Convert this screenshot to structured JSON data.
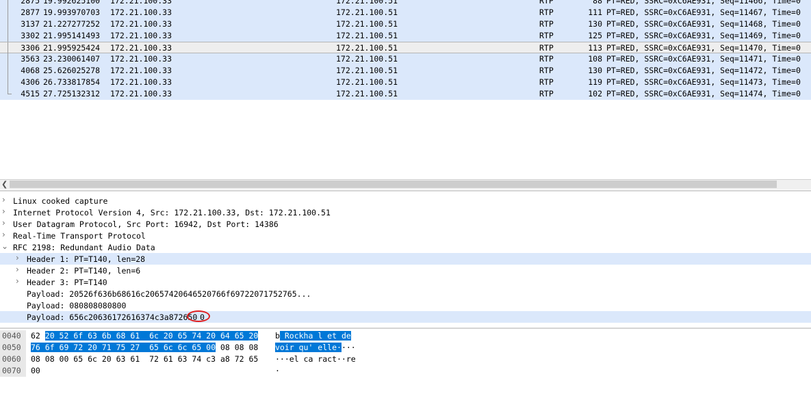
{
  "packet_list": {
    "rows": [
      {
        "no": "2875",
        "time": "19.992625100",
        "src": "172.21.100.33",
        "dst": "172.21.100.51",
        "proto": "RTP",
        "len": "88",
        "info": "PT=RED, SSRC=0xC6AE931, Seq=11466, Time=0"
      },
      {
        "no": "2877",
        "time": "19.993970703",
        "src": "172.21.100.33",
        "dst": "172.21.100.51",
        "proto": "RTP",
        "len": "111",
        "info": "PT=RED, SSRC=0xC6AE931, Seq=11467, Time=0"
      },
      {
        "no": "3137",
        "time": "21.227277252",
        "src": "172.21.100.33",
        "dst": "172.21.100.51",
        "proto": "RTP",
        "len": "130",
        "info": "PT=RED, SSRC=0xC6AE931, Seq=11468, Time=0"
      },
      {
        "no": "3302",
        "time": "21.995141493",
        "src": "172.21.100.33",
        "dst": "172.21.100.51",
        "proto": "RTP",
        "len": "125",
        "info": "PT=RED, SSRC=0xC6AE931, Seq=11469, Time=0"
      },
      {
        "no": "3306",
        "time": "21.995925424",
        "src": "172.21.100.33",
        "dst": "172.21.100.51",
        "proto": "RTP",
        "len": "113",
        "info": "PT=RED, SSRC=0xC6AE931, Seq=11470, Time=0"
      },
      {
        "no": "3563",
        "time": "23.230061407",
        "src": "172.21.100.33",
        "dst": "172.21.100.51",
        "proto": "RTP",
        "len": "108",
        "info": "PT=RED, SSRC=0xC6AE931, Seq=11471, Time=0"
      },
      {
        "no": "4068",
        "time": "25.626025278",
        "src": "172.21.100.33",
        "dst": "172.21.100.51",
        "proto": "RTP",
        "len": "130",
        "info": "PT=RED, SSRC=0xC6AE931, Seq=11472, Time=0"
      },
      {
        "no": "4306",
        "time": "26.733817854",
        "src": "172.21.100.33",
        "dst": "172.21.100.51",
        "proto": "RTP",
        "len": "119",
        "info": "PT=RED, SSRC=0xC6AE931, Seq=11473, Time=0"
      },
      {
        "no": "4515",
        "time": "27.725132312",
        "src": "172.21.100.33",
        "dst": "172.21.100.51",
        "proto": "RTP",
        "len": "102",
        "info": "PT=RED, SSRC=0xC6AE931, Seq=11474, Time=0"
      }
    ],
    "selected_row": "3306"
  },
  "details": {
    "linux_cooked": "Linux cooked capture",
    "ipv4": "Internet Protocol Version 4, Src: 172.21.100.33, Dst: 172.21.100.51",
    "udp": "User Datagram Protocol, Src Port: 16942, Dst Port: 14386",
    "rtp": "Real-Time Transport Protocol",
    "rfc2198": "RFC 2198: Redundant Audio Data",
    "header1": "Header 1: PT=T140, len=28",
    "header2": "Header 2: PT=T140, len=6",
    "header3": "Header 3: PT=T140",
    "payload1": "Payload: 20526f636b68616c20657420646520766f69722071752765...",
    "payload2": "Payload: 080808080800",
    "payload3": "Payload: 656c20636172616374c3a872650",
    "payload3_tail": "0"
  },
  "bytes": {
    "row1": {
      "offset": "0040",
      "hex_plain": "62 ",
      "hex_sel": "20 52 6f 63 6b 68 61  6c 20 65 74 20 64 65 20",
      "ascii_plain": "b",
      "ascii_sel": " Rockha l et de"
    },
    "row2": {
      "offset": "0050",
      "hex_sel": "76 6f 69 72 20 71 75 27  65 6c 6c 65 00",
      "hex_plain": " 08 08 08",
      "ascii_sel": "voir qu' elle·",
      "ascii_plain": "···"
    },
    "row3": {
      "offset": "0060",
      "hex_plain": "08 08 00 65 6c 20 63 61  72 61 63 74 c3 a8 72 65",
      "ascii_plain": "···el ca ract··re"
    },
    "row4": {
      "offset": "0070",
      "hex_plain": "00",
      "ascii_plain": "·"
    }
  },
  "icons": {
    "expand": "chevron-right-icon",
    "collapse": "chevron-down-icon",
    "scroll_left": "chevron-left-icon"
  },
  "colors": {
    "row_highlight": "#dbe8fb",
    "byte_selection": "#0078d7",
    "annotation_circle": "#e02020"
  }
}
